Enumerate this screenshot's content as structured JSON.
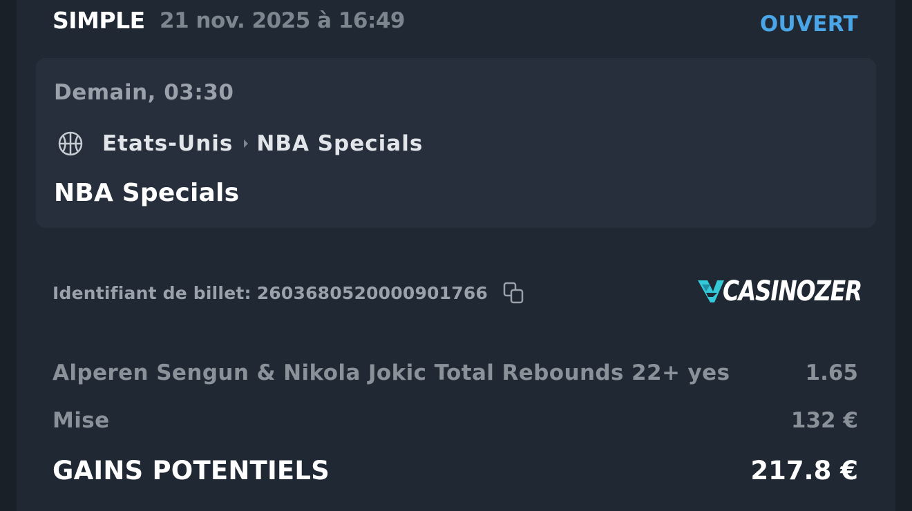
{
  "header": {
    "bet_type": "SIMPLE",
    "datetime": "21 nov. 2025 à 16:49",
    "status": "OUVERT"
  },
  "event": {
    "time": "Demain, 03:30",
    "sport_icon": "basketball-icon",
    "country": "Etats-Unis",
    "separator_icon": "chevron-right-icon",
    "league": "NBA Specials",
    "title": "NBA Specials"
  },
  "ticket": {
    "label": "Identifiant de billet:",
    "id": "2603680520000901766",
    "copy_icon": "copy-icon"
  },
  "brand": {
    "name": "CASINOZER",
    "accent_color": "#35c8d8"
  },
  "selection": {
    "name": "Alperen Sengun & Nikola Jokic Total Rebounds 22+ yes",
    "odds": "1.65"
  },
  "stake": {
    "label": "Mise",
    "value": "132 €"
  },
  "potential_gains": {
    "label": "GAINS POTENTIELS",
    "value": "217.8 €"
  },
  "colors": {
    "background": "#1a2028",
    "panel": "#202833",
    "card": "#262f3b",
    "status_blue": "#4aa6e6",
    "muted_text": "#8a9199"
  }
}
